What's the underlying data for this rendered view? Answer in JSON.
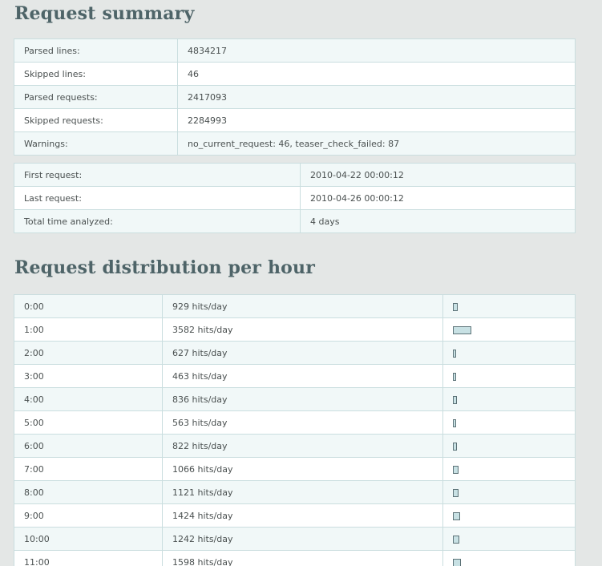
{
  "summary": {
    "title": "Request summary",
    "rows": [
      {
        "label": "Parsed lines:",
        "value": "4834217"
      },
      {
        "label": "Skipped lines:",
        "value": "46"
      },
      {
        "label": "Parsed requests:",
        "value": "2417093"
      },
      {
        "label": "Skipped requests:",
        "value": "2284993"
      },
      {
        "label": "Warnings:",
        "value": "no_current_request: 46, teaser_check_failed: 87"
      }
    ]
  },
  "time_range": {
    "rows": [
      {
        "label": "First request:",
        "value": "2010-04-22 00:00:12"
      },
      {
        "label": "Last request:",
        "value": "2010-04-26 00:00:12"
      },
      {
        "label": "Total time analyzed:",
        "value": "4 days"
      }
    ]
  },
  "distribution": {
    "title": "Request distribution per hour",
    "rows": [
      {
        "hour": "0:00",
        "hits": "929 hits/day",
        "value": 929
      },
      {
        "hour": "1:00",
        "hits": "3582 hits/day",
        "value": 3582
      },
      {
        "hour": "2:00",
        "hits": "627 hits/day",
        "value": 627
      },
      {
        "hour": "3:00",
        "hits": "463 hits/day",
        "value": 463
      },
      {
        "hour": "4:00",
        "hits": "836 hits/day",
        "value": 836
      },
      {
        "hour": "5:00",
        "hits": "563 hits/day",
        "value": 563
      },
      {
        "hour": "6:00",
        "hits": "822 hits/day",
        "value": 822
      },
      {
        "hour": "7:00",
        "hits": "1066 hits/day",
        "value": 1066
      },
      {
        "hour": "8:00",
        "hits": "1121 hits/day",
        "value": 1121
      },
      {
        "hour": "9:00",
        "hits": "1424 hits/day",
        "value": 1424
      },
      {
        "hour": "10:00",
        "hits": "1242 hits/day",
        "value": 1242
      },
      {
        "hour": "11:00",
        "hits": "1598 hits/day",
        "value": 1598
      }
    ]
  },
  "colors": {
    "background": "#e4e7e6",
    "heading": "#4e6468",
    "row_alt": "#f1f8f8",
    "border": "#cadedf",
    "bar_fill": "#c8e1e4",
    "bar_border": "#5c7277"
  }
}
